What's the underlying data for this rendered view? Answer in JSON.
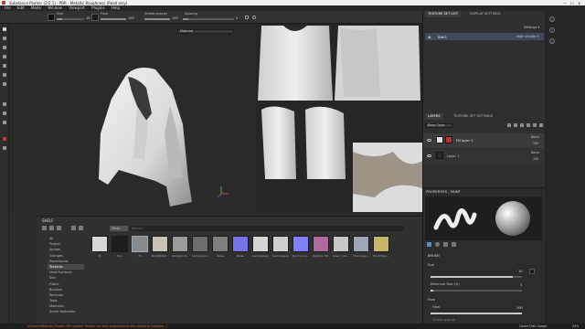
{
  "window": {
    "title": "Substance Painter (2/2.1) - PBR - Metallic Roughness (Read only)",
    "controls": [
      "—",
      "☐",
      "✕"
    ]
  },
  "menu": [
    "File",
    "Edit",
    "Mode",
    "Window",
    "Viewport",
    "Plugins",
    "Help"
  ],
  "toolbar": {
    "size_label": "Size",
    "size_value": "10",
    "flow_label": "Flow",
    "flow_value": "100",
    "opacity_label": "Stroke opacity",
    "opacity_value": "100",
    "spacing_label": "Spacing",
    "spacing_value": "5"
  },
  "viewport": {
    "material_mode_3d": "Material",
    "material_mode_2d": "Material",
    "colors": {
      "cloth_white": "#e6e6e6",
      "cloth_shadow": "#9c9c9c",
      "bg": "#2a2a2a"
    }
  },
  "shelf": {
    "title": "SHELF",
    "search_placeholder": "Search...",
    "filter_label": "Textu",
    "categories": [
      "All",
      "Project",
      "Alphas",
      "Grunges",
      "Procedurals",
      "Textures",
      "Hard Surfaces",
      "Skin",
      "Filters",
      "Brushes",
      "Particles",
      "Tools",
      "Materials",
      "Smart materials"
    ],
    "selected_category": "Textures",
    "items": [
      {
        "name": "f1",
        "color": "#d8d8d8"
      },
      {
        "name": "f1.1",
        "color": "#1e1e1e"
      },
      {
        "name": "f3",
        "color": "#8a8a8a"
      },
      {
        "name": "BlobBlobbi...",
        "color": "#c9c2b6"
      },
      {
        "name": "Ambient O...",
        "color": "#9a9a9a"
      },
      {
        "name": "Curvature 1",
        "color": "#6e6e6e"
      },
      {
        "name": "Glass",
        "color": "#7f7f7f"
      },
      {
        "name": "Noise",
        "color": "#7575e8"
      },
      {
        "name": "Gamedesign...",
        "color": "#d6d6d6"
      },
      {
        "name": "Gamedesig...",
        "color": "#cfcfcf"
      },
      {
        "name": "Normal Gu...",
        "color": "#8080ff"
      },
      {
        "name": "Position HD...",
        "color": "#b06aa0"
      },
      {
        "name": "Linen_colo...",
        "color": "#c7c7c7"
      },
      {
        "name": "Thickness ...",
        "color": "#9fa6b6"
      },
      {
        "name": "World Spa...",
        "color": "#c7b66a"
      }
    ]
  },
  "texture_set": {
    "tabs": [
      "TEXTURE SET LIST",
      "DISPLAY SETTINGS"
    ],
    "settings_label": "Settings ▾",
    "item_name": "SHE1",
    "shader_label": "Main shader ▾"
  },
  "layers": {
    "tabs": [
      "LAYERS",
      "TEXTURE SET SETTINGS"
    ],
    "channel": "Base Color",
    "items": [
      {
        "name": "Fill layer 1",
        "blend": "Norm",
        "opacity": "100"
      },
      {
        "name": "Layer 1",
        "blend": "Norm",
        "opacity": "100"
      }
    ]
  },
  "properties": {
    "title": "PROPERTIES - PAINT",
    "section": "BRUSH",
    "size_label": "Size",
    "size_value": "10",
    "min_size_label": "Minimum Size (%)",
    "min_size_value": "3",
    "flow_label": "Flow",
    "flow_section": "Flow",
    "flow_value": "100",
    "spacing_label": "Stroke opacity",
    "size_frac": 0.9,
    "min_size_frac": 0.03,
    "flow_frac": 1.0
  },
  "status": {
    "message": "[GenericMaterial] Shader API update: Shader not fully supported on this platform (shadow...)",
    "cache": "Cache Disk Usage:",
    "cache_value": "33%"
  }
}
